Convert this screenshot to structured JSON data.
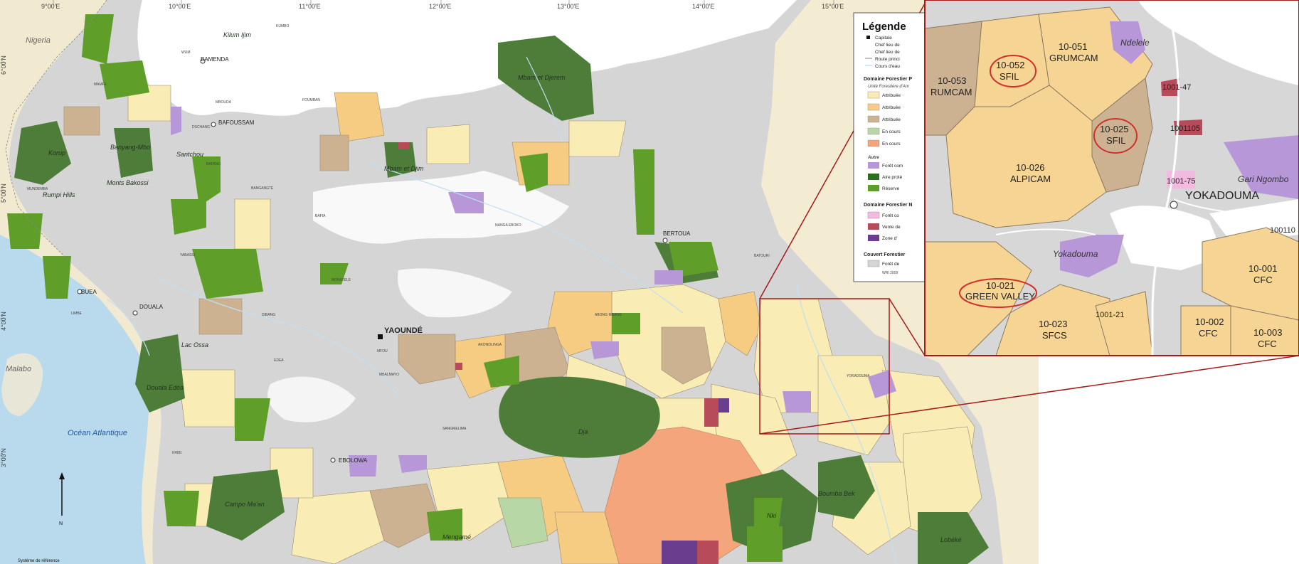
{
  "coords_top": [
    "9°00'E",
    "10°00'E",
    "11°00'E",
    "12°00'E",
    "13°00'E",
    "14°00'E",
    "15°00'E"
  ],
  "coords_left": [
    "6°00'N",
    "5°00'N",
    "4°00'N",
    "3°00'N"
  ],
  "countries": {
    "nigeria": "Nigeria",
    "malabo": "Malabo"
  },
  "ocean": "Océan Atlantique",
  "cities": {
    "yaounde": "YAOUNDÉ",
    "douala": "DOUALA",
    "bamenda": "BAMENDA",
    "bafoussam": "BAFOUSSAM",
    "bertoua": "BERTOUA",
    "ebolowa": "EBOLOWA",
    "buea": "BUEA",
    "kumbo": "KUMBO",
    "foumban": "FOUMBAN",
    "nanga": "NANGA EBOKO",
    "batouri": "BATOURI",
    "yokadouma": "YOKADOUMA",
    "sangmelima": "SANGMELIMA",
    "kribi": "KRIBI",
    "mbalmayo": "MBALMAYO",
    "edea": "EDEA",
    "abong": "ABONG MBANG",
    "akonolinga": "AKONOLINGA",
    "monatele": "MONATELE",
    "mfou": "MFOU",
    "yabassi": "YABASSI",
    "dibang": "DIBANG",
    "limbe": "LIMBE",
    "dschang": "DSCHANG",
    "bafang": "BAFANG",
    "bangangte": "BANGANGTE",
    "mbouda": "MBOUDA",
    "wum": "WUM",
    "mamfe": "MAMFE",
    "bafia": "BAFIA",
    "mundemba": "MUNDEMBA"
  },
  "parks": {
    "kilum": "Kilum Ijim",
    "mbamdjerem": "Mbam et Djerem",
    "mbamdjim": "Mbam et Djim",
    "korup": "Korup",
    "banyang": "Banyang-Mbo",
    "santchou": "Santchou",
    "bakossi": "Monts Bakossi",
    "rumpi": "Rumpi Hills",
    "dja": "Dja",
    "campo": "Campo Ma'an",
    "mengame": "Mengamé",
    "nki": "Nki",
    "boumba": "Boumba Bek",
    "lobeke": "Lobéké",
    "douala_edea": "Douala Edéa",
    "lacossa": "Lac Ossa"
  },
  "north_label": "N",
  "ref_label": "Système de référence",
  "legend": {
    "title": "Légende",
    "items_top": [
      "Capitale",
      "Chef lieu de",
      "Chef lieu de",
      "Route princi",
      "Cours d'eau"
    ],
    "section1": "Domaine Forestier P",
    "sub1": "Unité Forestière d'Am",
    "items1": [
      "Attribuée",
      "Attribuée",
      "Attribuée",
      "En cours",
      "En cours"
    ],
    "sub2": "Autre",
    "items2": [
      "Forêt com",
      "Aire proté",
      "Réserve"
    ],
    "section2": "Domaine Forestier N",
    "items3": [
      "Forêt co",
      "Vente de",
      "Zone d'"
    ],
    "section3": "Couvert Forestier",
    "items4": [
      "Forêt de"
    ],
    "footer": "WRI 2009"
  },
  "zoom": {
    "units": [
      {
        "id": "10-051",
        "name": "GRUMCAM"
      },
      {
        "id": "10-052",
        "name": "SFIL"
      },
      {
        "id": "10-053",
        "name": "RUMCAM"
      },
      {
        "id": "10-025",
        "name": "SFIL"
      },
      {
        "id": "10-026",
        "name": "ALPICAM"
      },
      {
        "id": "10-021",
        "name": "GREEN VALLEY"
      },
      {
        "id": "10-023",
        "name": "SFCS"
      },
      {
        "id": "10-001",
        "name": "CFC"
      },
      {
        "id": "10-002",
        "name": "CFC"
      },
      {
        "id": "10-003",
        "name": "CFC"
      }
    ],
    "ndelele": "Ndelele",
    "gari": "Gari Ngombo",
    "yoka_park": "Yokadouma",
    "yoka_city": "YOKADOUMA",
    "plots": [
      "1001-47",
      "1001105",
      "1001-75",
      "1001-21",
      "100110"
    ]
  },
  "colors": {
    "sea": "#b8d9ec",
    "grey": "#d4d4d4",
    "white": "#ffffff",
    "land": "#f2ead0",
    "protected_dark": "#4e7d3a",
    "reserve": "#5f9e28",
    "community": "#b797d8",
    "attrib_yellow": "#f9ecb4",
    "attrib_orange": "#f6cc82",
    "attrib_brown": "#cdb292",
    "en_cours_green": "#b7d8a6",
    "en_cours_salmon": "#f5a57b",
    "vente": "#b74b5a",
    "zone": "#6a3d8f",
    "foret_comm": "#f2b9e1",
    "zoom_border": "#a41b1b",
    "highlight": "#d0312d"
  }
}
